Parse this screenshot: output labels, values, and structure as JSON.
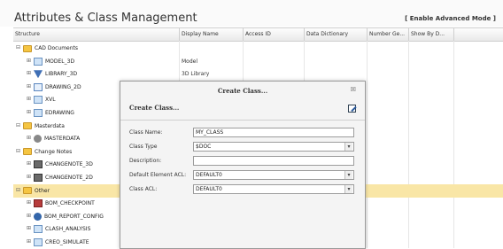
{
  "header": {
    "title": "Attributes & Class Management",
    "advanced_link": "[ Enable Advanced Mode ]"
  },
  "columns": [
    "Structure",
    "Display Name",
    "Access ID",
    "Data Dictionary",
    "Number Ge...",
    "Show By D..."
  ],
  "tree": [
    {
      "expander": "⊟",
      "icon": "folder-icon",
      "label": "CAD Documents",
      "display": ""
    },
    {
      "expander": "⊞",
      "icon": "document-icon",
      "label": "MODEL_3D",
      "display": "Model"
    },
    {
      "expander": "⊞",
      "icon": "library-icon",
      "label": "LIBRARY_3D",
      "display": "3D Library"
    },
    {
      "expander": "⊞",
      "icon": "drawing-icon",
      "label": "DRAWING_2D",
      "display": ""
    },
    {
      "expander": "⊞",
      "icon": "document-icon",
      "label": "XVL",
      "display": ""
    },
    {
      "expander": "⊞",
      "icon": "document-icon",
      "label": "EDRAWING",
      "display": ""
    },
    {
      "expander": "⊟",
      "icon": "folder-icon",
      "label": "Masterdata",
      "display": ""
    },
    {
      "expander": "⊞",
      "icon": "masterdata-icon",
      "label": "MASTERDATA",
      "display": ""
    },
    {
      "expander": "⊟",
      "icon": "folder-icon",
      "label": "Change Notes",
      "display": ""
    },
    {
      "expander": "⊞",
      "icon": "changenote-icon",
      "label": "CHANGENOTE_3D",
      "display": ""
    },
    {
      "expander": "⊞",
      "icon": "changenote-icon",
      "label": "CHANGENOTE_2D",
      "display": ""
    },
    {
      "expander": "⊟",
      "icon": "folder-icon",
      "label": "Other",
      "display": ""
    },
    {
      "expander": "⊞",
      "icon": "bom-checkpoint-icon",
      "label": "BOM_CHECKPOINT",
      "display": ""
    },
    {
      "expander": "⊞",
      "icon": "bom-report-icon",
      "label": "BOM_REPORT_CONFIG",
      "display": ""
    },
    {
      "expander": "⊞",
      "icon": "document-icon",
      "label": "CLASH_ANALYSIS",
      "display": ""
    },
    {
      "expander": "⊞",
      "icon": "document-icon",
      "label": "CREO_SIMULATE",
      "display": ""
    }
  ],
  "dialog": {
    "title": "Create Class...",
    "close_symbol": "☒",
    "subtitle": "Create Class...",
    "fields": [
      {
        "label": "Class Name:",
        "value": "MY_CLASS"
      },
      {
        "label": "Class Type",
        "value": "$DOC"
      },
      {
        "label": "Description:",
        "value": ""
      },
      {
        "label": "Default Element ACL:",
        "value": "DEFAULT0"
      },
      {
        "label": "Class ACL:",
        "value": "DEFAULT0"
      }
    ]
  }
}
